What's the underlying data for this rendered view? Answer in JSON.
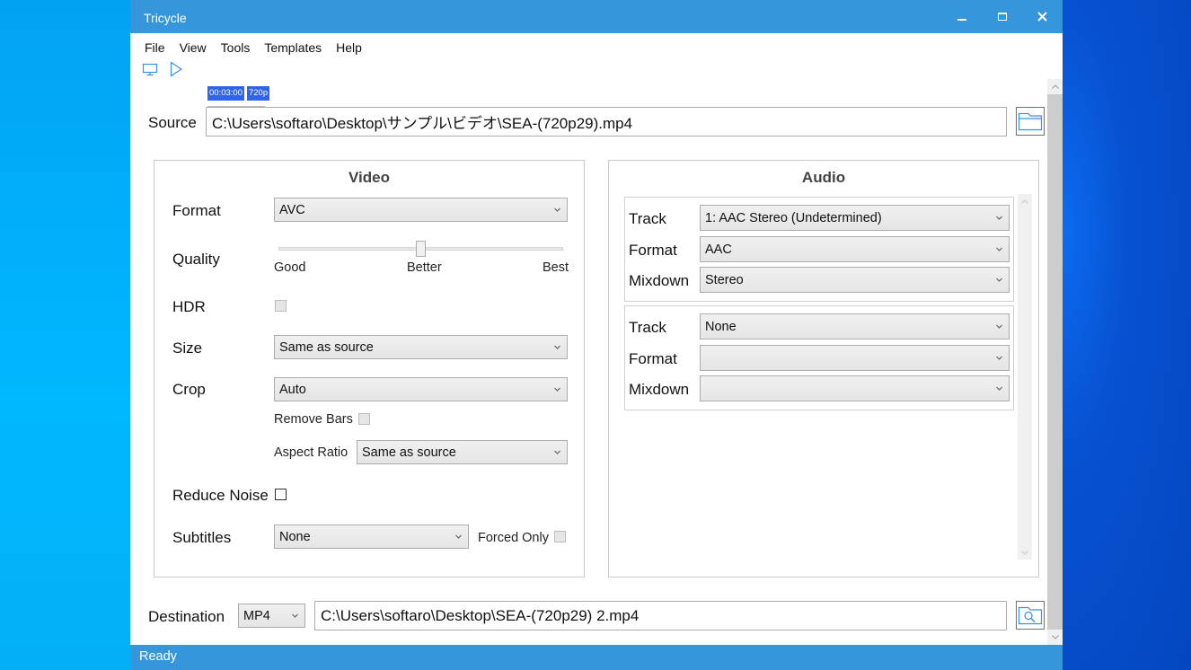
{
  "window": {
    "title": "Tricycle",
    "controls": {
      "minimize": "minimize",
      "maximize": "maximize",
      "close": "close"
    }
  },
  "menu": {
    "items": [
      {
        "label": "File"
      },
      {
        "label": "View"
      },
      {
        "label": "Tools"
      },
      {
        "label": "Templates"
      },
      {
        "label": "Help"
      }
    ]
  },
  "toolbar": {
    "preview_icon": "monitor-icon",
    "start_icon": "play-icon"
  },
  "source_info": {
    "duration": "00:03:00",
    "resolution": "720p"
  },
  "source": {
    "label": "Source",
    "path": "C:\\Users\\softaro\\Desktop\\サンプル\\ビデオ\\SEA-(720p29).mp4",
    "browse_icon": "folder-icon"
  },
  "video": {
    "title": "Video",
    "format": {
      "label": "Format",
      "value": "AVC"
    },
    "quality": {
      "label": "Quality",
      "ticks": [
        "Good",
        "Better",
        "Best"
      ],
      "value_fraction": 0.5
    },
    "hdr": {
      "label": "HDR",
      "checked": false,
      "enabled": false
    },
    "size": {
      "label": "Size",
      "value": "Same as source"
    },
    "crop": {
      "label": "Crop",
      "value": "Auto"
    },
    "remove_bars": {
      "label": "Remove Bars",
      "checked": false,
      "enabled": false
    },
    "aspect_ratio": {
      "label": "Aspect Ratio",
      "value": "Same as source"
    },
    "reduce_noise": {
      "label": "Reduce Noise",
      "checked": false
    },
    "subtitles": {
      "label": "Subtitles",
      "value": "None"
    },
    "forced_only": {
      "label": "Forced Only",
      "checked": false,
      "enabled": false
    }
  },
  "audio": {
    "title": "Audio",
    "tracks": [
      {
        "track_label": "Track",
        "track_value": "1: AAC Stereo (Undetermined)",
        "format_label": "Format",
        "format_value": "AAC",
        "mixdown_label": "Mixdown",
        "mixdown_value": "Stereo"
      },
      {
        "track_label": "Track",
        "track_value": "None",
        "format_label": "Format",
        "format_value": "",
        "mixdown_label": "Mixdown",
        "mixdown_value": ""
      }
    ]
  },
  "destination": {
    "label": "Destination",
    "container": "MP4",
    "path": "C:\\Users\\softaro\\Desktop\\SEA-(720p29) 2.mp4",
    "browse_icon": "folder-search-icon"
  },
  "status": {
    "text": "Ready"
  },
  "colors": {
    "accent": "#3596db",
    "badge": "#2f63ea",
    "icon_blue": "#3b8ee8"
  }
}
